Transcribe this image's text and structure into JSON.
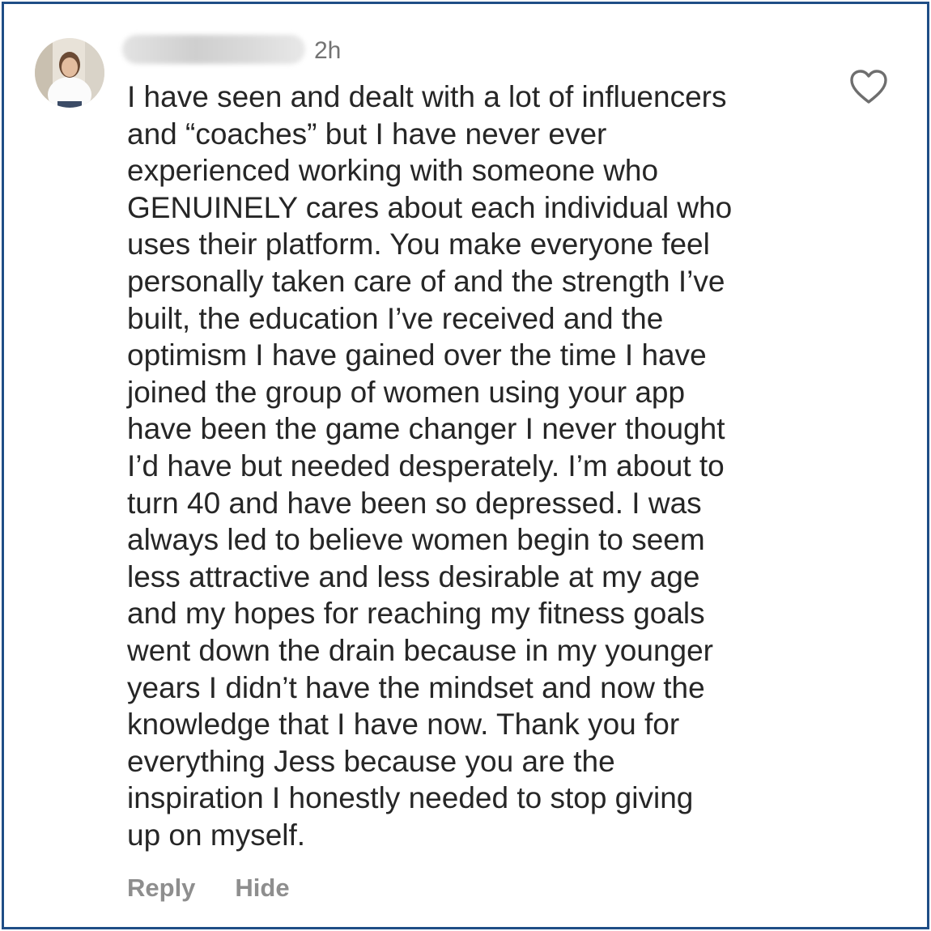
{
  "comment": {
    "author_avatar": "user-avatar",
    "timestamp": "2h",
    "text": "I have seen and dealt with a lot of influencers\nand “coaches” but I have never ever\nexperienced working with someone who\nGENUINELY cares about each individual who\nuses their platform. You make everyone feel\npersonally taken care of and the strength I’ve\nbuilt, the education I’ve received and the\noptimism I have gained over the time I have\njoined the group of women using your app\nhave been the game changer I never thought\nI’d have but needed desperately. I’m about to\nturn 40 and have been so depressed. I was\nalways led to believe women begin to seem\nless attractive and less desirable at my age\nand my hopes for reaching my fitness goals\nwent down the drain because in my younger\nyears I didn’t have the mindset and now the\nknowledge that I have now. Thank you for\neverything Jess because you are the\ninspiration I honestly needed to stop giving\nup on myself.",
    "like_icon": "heart-outline-icon"
  },
  "actions": {
    "reply_label": "Reply",
    "hide_label": "Hide"
  },
  "colors": {
    "border": "#1f4e86",
    "text": "#262626",
    "muted": "#8e8e8e",
    "timestamp": "#737373"
  }
}
